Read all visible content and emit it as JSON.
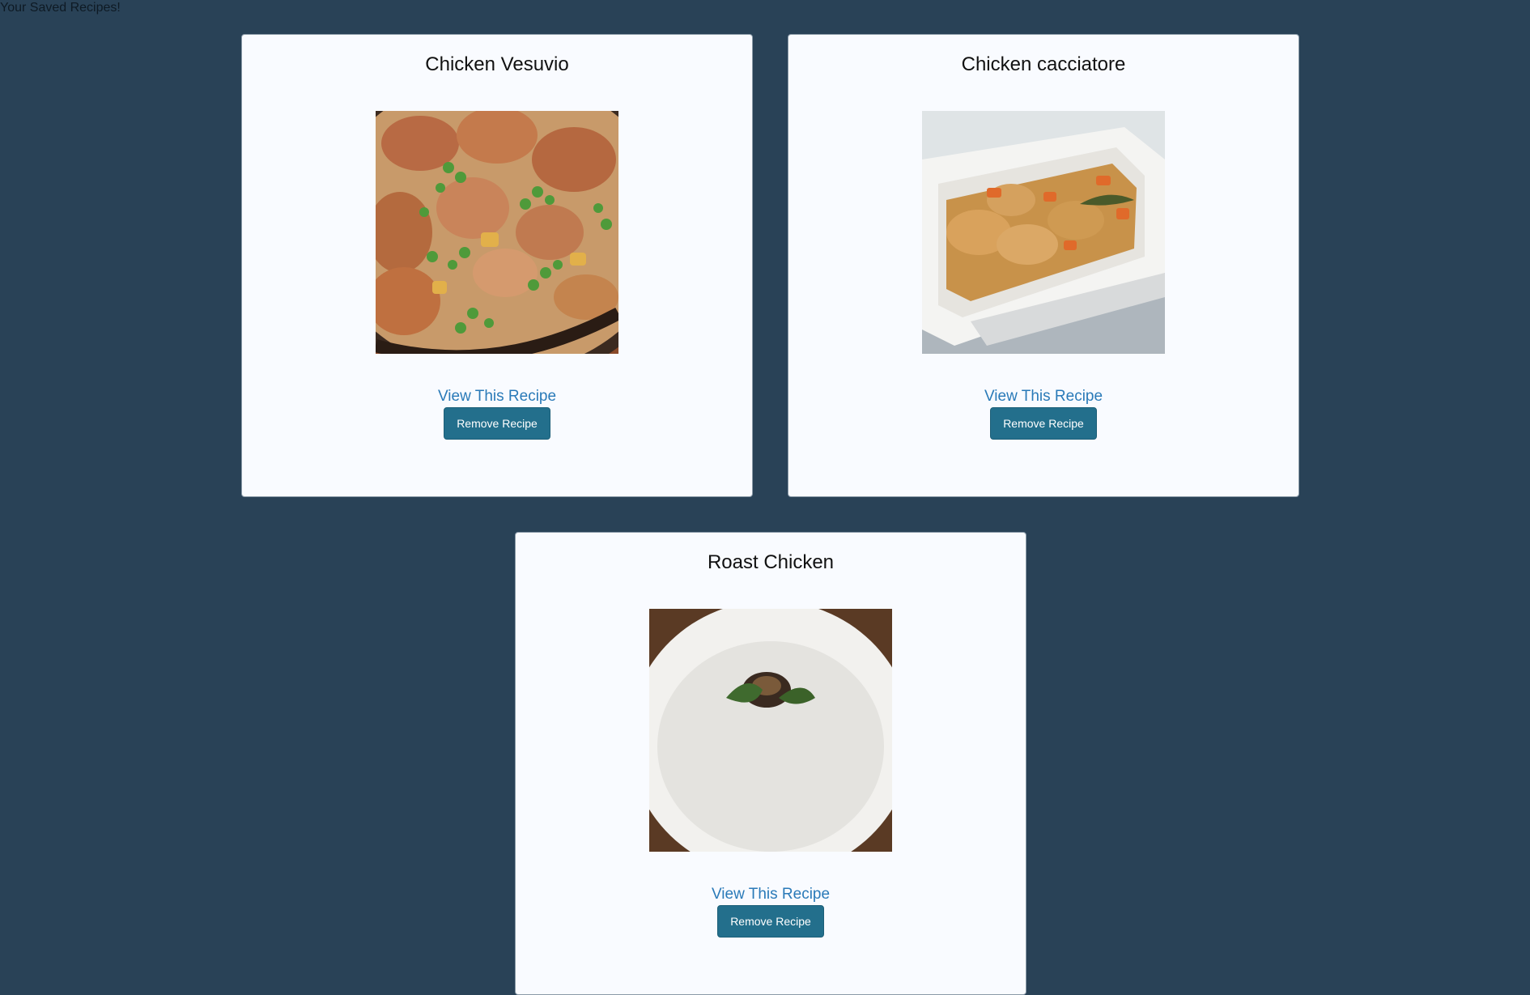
{
  "page": {
    "heading": "Your Saved Recipes!"
  },
  "recipes": [
    {
      "title": "Chicken Vesuvio",
      "image_alt": "Chicken Vesuvio dish with peas and potatoes in a pan",
      "view_label": "View This Recipe",
      "remove_label": "Remove Recipe"
    },
    {
      "title": "Chicken cacciatore",
      "image_alt": "Chicken cacciatore with carrots in a white baking dish",
      "view_label": "View This Recipe",
      "remove_label": "Remove Recipe"
    },
    {
      "title": "Roast Chicken",
      "image_alt": "Roast chicken in a white bowl",
      "view_label": "View This Recipe",
      "remove_label": "Remove Recipe"
    }
  ],
  "colors": {
    "background": "#294257",
    "card": "#f9fbff",
    "link": "#2a7ab8",
    "button": "#236f8c"
  }
}
